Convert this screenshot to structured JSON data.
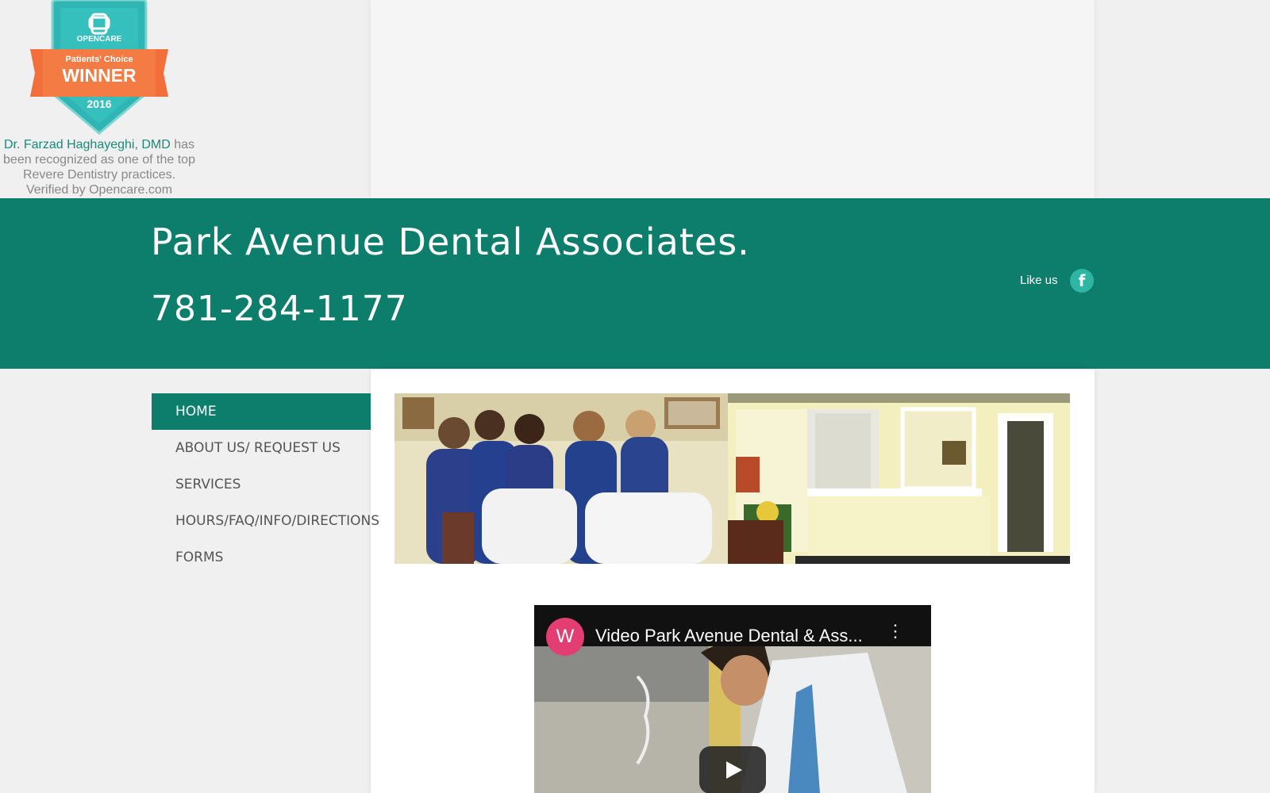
{
  "badge": {
    "brand": "OPENCARE",
    "award_line": "Patients' Choice",
    "award_main": "WINNER",
    "year": "2016",
    "doctor_link": "Dr. Farzad Haghayeghi, DMD",
    "caption_rest": " has been recognized as one of the top Revere Dentistry practices.",
    "verified": "Verified by Opencare.com"
  },
  "header": {
    "title": "Park Avenue Dental Associates.",
    "phone": "781-284-1177",
    "like_label": "Like us",
    "facebook_icon": "f"
  },
  "nav": {
    "items": [
      {
        "label": "HOME",
        "active": true
      },
      {
        "label": "ABOUT US/ REQUEST US",
        "active": false
      },
      {
        "label": "SERVICES",
        "active": false
      },
      {
        "label": "HOURS/FAQ/INFO/DIRECTIONS",
        "active": false
      },
      {
        "label": "FORMS",
        "active": false
      }
    ]
  },
  "video": {
    "avatar_letter": "W",
    "title": "Video Park Avenue Dental & Ass...",
    "menu_icon": "more-vert-icon",
    "play_icon": "play-icon"
  },
  "colors": {
    "brand_teal": "#0e7e6c",
    "fb_teal": "#2fb5a3",
    "badge_teal": "#2fb5b3",
    "badge_orange": "#f26f3c",
    "avatar_pink": "#e33e73"
  }
}
